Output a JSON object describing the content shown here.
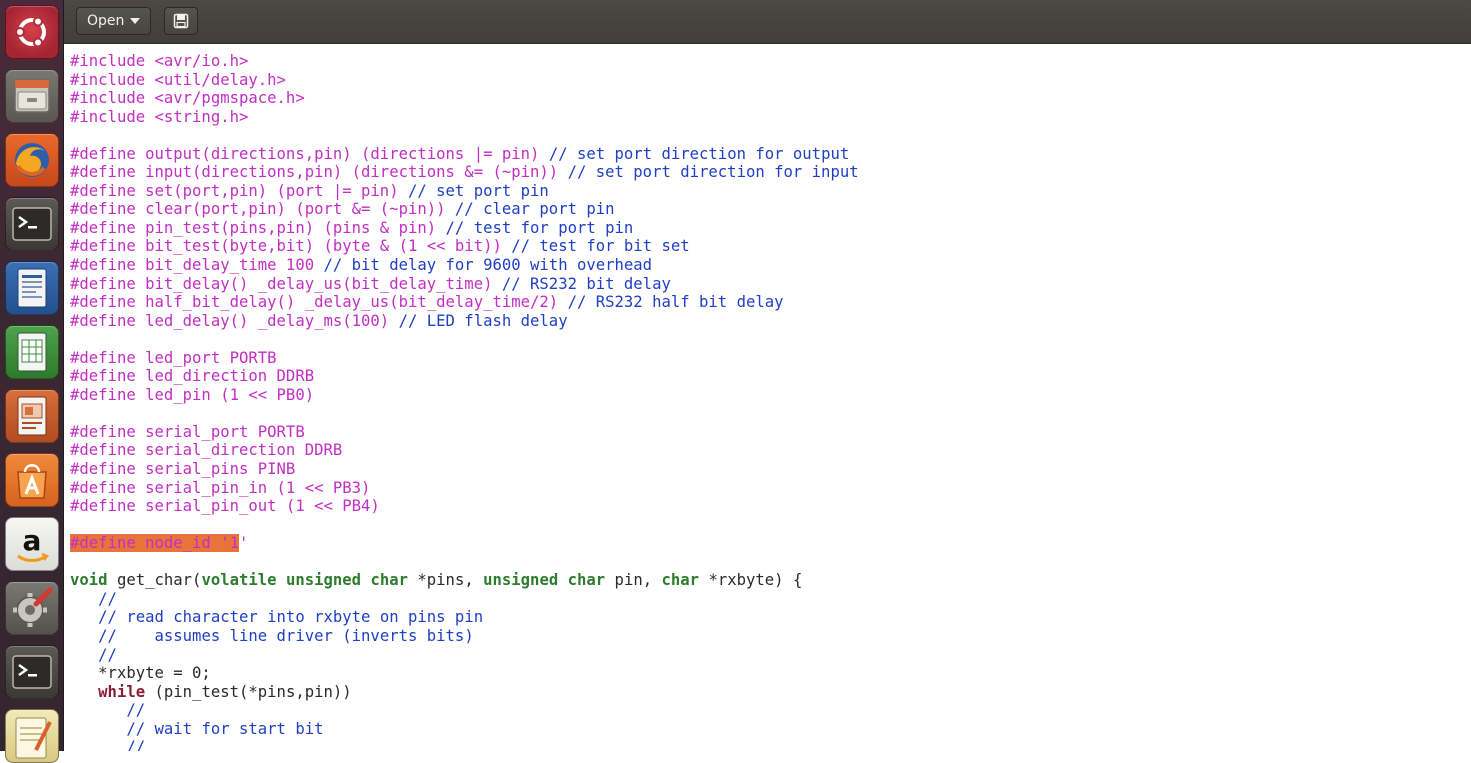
{
  "toolbar": {
    "open_label": "Open"
  },
  "launcher": {
    "items": [
      {
        "name": "dash-home-icon"
      },
      {
        "name": "file-manager-icon"
      },
      {
        "name": "firefox-icon"
      },
      {
        "name": "terminal-icon"
      },
      {
        "name": "writer-icon"
      },
      {
        "name": "calc-icon"
      },
      {
        "name": "impress-icon"
      },
      {
        "name": "software-center-icon"
      },
      {
        "name": "amazon-icon"
      },
      {
        "name": "system-settings-icon"
      },
      {
        "name": "terminal-2-icon"
      },
      {
        "name": "text-editor-icon"
      }
    ]
  },
  "editor": {
    "lines": [
      [
        {
          "t": "pp",
          "s": "#include <avr/io.h>"
        }
      ],
      [
        {
          "t": "pp",
          "s": "#include <util/delay.h>"
        }
      ],
      [
        {
          "t": "pp",
          "s": "#include <avr/pgmspace.h>"
        }
      ],
      [
        {
          "t": "pp",
          "s": "#include <string.h>"
        }
      ],
      [],
      [
        {
          "t": "pp",
          "s": "#define output(directions,pin) (directions |= pin) "
        },
        {
          "t": "cm",
          "s": "// set port direction for output"
        }
      ],
      [
        {
          "t": "pp",
          "s": "#define input(directions,pin) (directions &= (~pin)) "
        },
        {
          "t": "cm",
          "s": "// set port direction for input"
        }
      ],
      [
        {
          "t": "pp",
          "s": "#define set(port,pin) (port |= pin) "
        },
        {
          "t": "cm",
          "s": "// set port pin"
        }
      ],
      [
        {
          "t": "pp",
          "s": "#define clear(port,pin) (port &= (~pin)) "
        },
        {
          "t": "cm",
          "s": "// clear port pin"
        }
      ],
      [
        {
          "t": "pp",
          "s": "#define pin_test(pins,pin) (pins & pin) "
        },
        {
          "t": "cm",
          "s": "// test for port pin"
        }
      ],
      [
        {
          "t": "pp",
          "s": "#define bit_test(byte,bit) (byte & (1 << bit)) "
        },
        {
          "t": "cm",
          "s": "// test for bit set"
        }
      ],
      [
        {
          "t": "pp",
          "s": "#define bit_delay_time 100 "
        },
        {
          "t": "cm",
          "s": "// bit delay for 9600 with overhead"
        }
      ],
      [
        {
          "t": "pp",
          "s": "#define bit_delay() _delay_us(bit_delay_time) "
        },
        {
          "t": "cm",
          "s": "// RS232 bit delay"
        }
      ],
      [
        {
          "t": "pp",
          "s": "#define half_bit_delay() _delay_us(bit_delay_time/2) "
        },
        {
          "t": "cm",
          "s": "// RS232 half bit delay"
        }
      ],
      [
        {
          "t": "pp",
          "s": "#define led_delay() _delay_ms(100) "
        },
        {
          "t": "cm",
          "s": "// LED flash delay"
        }
      ],
      [],
      [
        {
          "t": "pp",
          "s": "#define led_port PORTB"
        }
      ],
      [
        {
          "t": "pp",
          "s": "#define led_direction DDRB"
        }
      ],
      [
        {
          "t": "pp",
          "s": "#define led_pin (1 << PB0)"
        }
      ],
      [],
      [
        {
          "t": "pp",
          "s": "#define serial_port PORTB"
        }
      ],
      [
        {
          "t": "pp",
          "s": "#define serial_direction DDRB"
        }
      ],
      [
        {
          "t": "pp",
          "s": "#define serial_pins PINB"
        }
      ],
      [
        {
          "t": "pp",
          "s": "#define serial_pin_in (1 << PB3)"
        }
      ],
      [
        {
          "t": "pp",
          "s": "#define serial_pin_out (1 << PB4)"
        }
      ],
      [],
      [
        {
          "t": "sel",
          "s": "#define node_id '1"
        },
        {
          "t": "pp",
          "s": "'"
        }
      ],
      [],
      [
        {
          "t": "kw",
          "s": "void"
        },
        {
          "t": "plain",
          "s": " get_char("
        },
        {
          "t": "kw",
          "s": "volatile unsigned char"
        },
        {
          "t": "plain",
          "s": " *pins, "
        },
        {
          "t": "kw",
          "s": "unsigned char"
        },
        {
          "t": "plain",
          "s": " pin, "
        },
        {
          "t": "kw",
          "s": "char"
        },
        {
          "t": "plain",
          "s": " *rxbyte) {"
        }
      ],
      [
        {
          "t": "plain",
          "s": "   "
        },
        {
          "t": "cm",
          "s": "//"
        }
      ],
      [
        {
          "t": "plain",
          "s": "   "
        },
        {
          "t": "cm",
          "s": "// read character into rxbyte on pins pin"
        }
      ],
      [
        {
          "t": "plain",
          "s": "   "
        },
        {
          "t": "cm",
          "s": "//    assumes line driver (inverts bits)"
        }
      ],
      [
        {
          "t": "plain",
          "s": "   "
        },
        {
          "t": "cm",
          "s": "//"
        }
      ],
      [
        {
          "t": "plain",
          "s": "   *rxbyte = 0;"
        }
      ],
      [
        {
          "t": "plain",
          "s": "   "
        },
        {
          "t": "ctl",
          "s": "while"
        },
        {
          "t": "plain",
          "s": " (pin_test(*pins,pin))"
        }
      ],
      [
        {
          "t": "plain",
          "s": "      "
        },
        {
          "t": "cm",
          "s": "//"
        }
      ],
      [
        {
          "t": "plain",
          "s": "      "
        },
        {
          "t": "cm",
          "s": "// wait for start bit"
        }
      ],
      [
        {
          "t": "plain",
          "s": "      "
        },
        {
          "t": "cm",
          "s": "//"
        }
      ]
    ]
  }
}
